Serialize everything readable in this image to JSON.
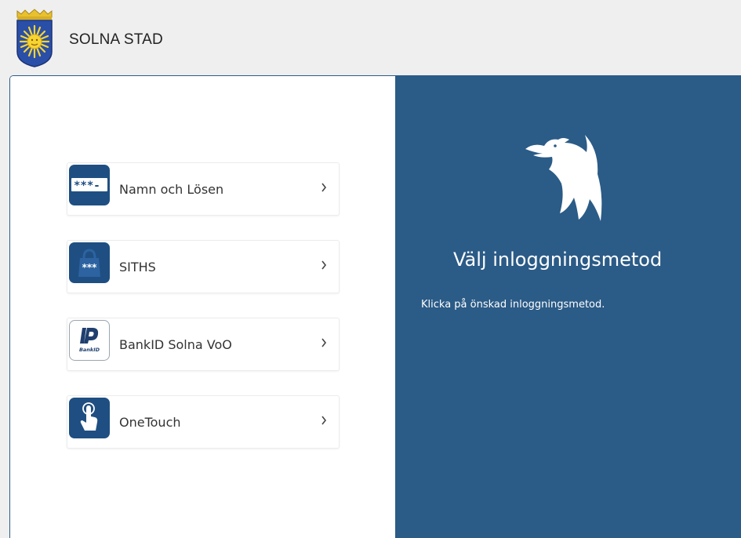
{
  "header": {
    "brand_name": "SOLNA STAD",
    "logo_icon": "solna-coat-of-arms-icon"
  },
  "methods": [
    {
      "label": "Namn och Lösen",
      "icon": "password-icon"
    },
    {
      "label": "SITHS",
      "icon": "siths-card-icon"
    },
    {
      "label": "BankID Solna VoO",
      "icon": "bankid-icon"
    },
    {
      "label": "OneTouch",
      "icon": "touch-finger-icon"
    }
  ],
  "panel": {
    "title": "Välj inloggningsmetod",
    "instruction": "Klicka på önskad inloggningsmetod.",
    "bird_icon": "bird-icon"
  },
  "colors": {
    "panel_blue": "#2b5b87",
    "icon_blue": "#1f4f82",
    "background": "#efefef"
  }
}
